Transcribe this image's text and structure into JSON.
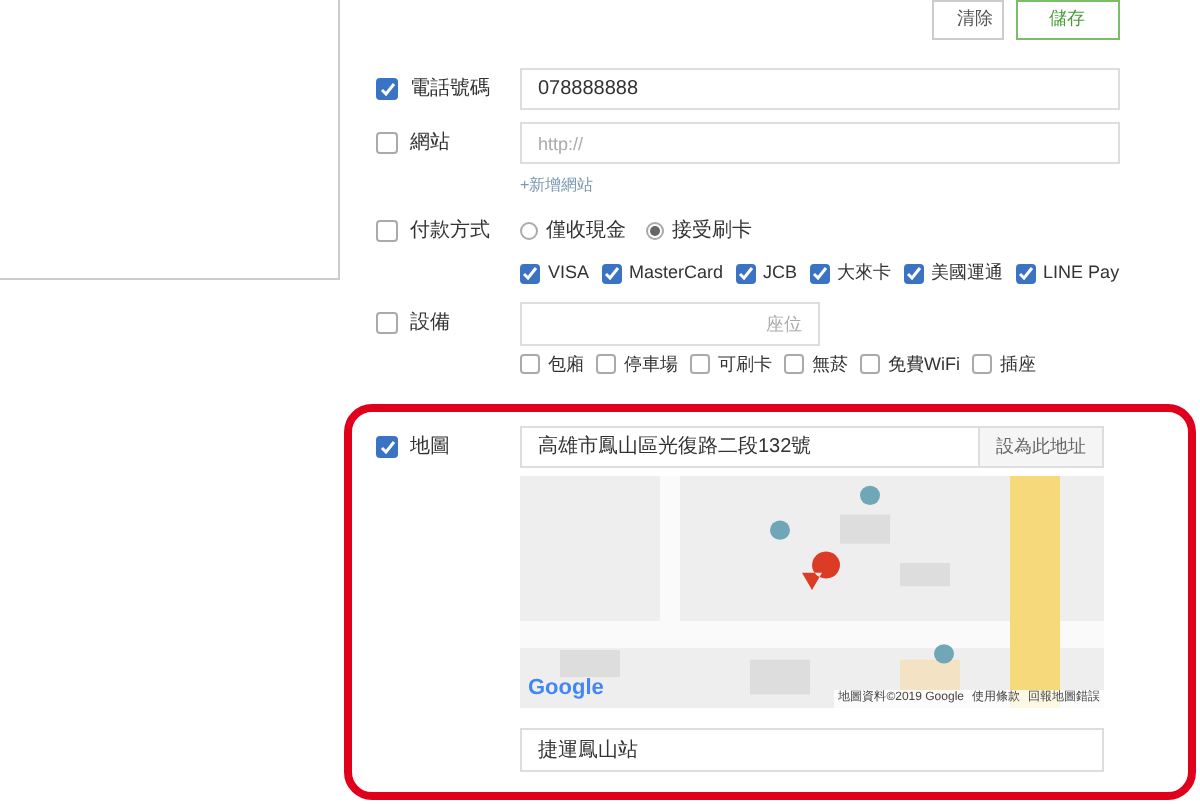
{
  "actions": [
    {
      "label": "清除",
      "kind": "plain"
    },
    {
      "label": "儲存",
      "kind": "primary"
    }
  ],
  "phone": {
    "label": "電話號碼",
    "checked": true,
    "value": "078888888"
  },
  "website": {
    "label": "網站",
    "checked": false,
    "placeholder": "http://",
    "add_link": "+新增網站"
  },
  "payment": {
    "label": "付款方式",
    "checked": false,
    "options": [
      {
        "label": "僅收現金",
        "selected": false
      },
      {
        "label": "接受刷卡",
        "selected": true
      }
    ],
    "cards": [
      {
        "label": "VISA",
        "checked": true
      },
      {
        "label": "MasterCard",
        "checked": true
      },
      {
        "label": "JCB",
        "checked": true
      },
      {
        "label": "大來卡",
        "checked": true
      },
      {
        "label": "美國運通",
        "checked": true
      },
      {
        "label": "LINE Pay",
        "checked": true
      }
    ]
  },
  "facilities": {
    "label": "設備",
    "checked": false,
    "placeholder": "座位",
    "items": [
      {
        "label": "包廂",
        "checked": false
      },
      {
        "label": "停車場",
        "checked": false
      },
      {
        "label": "可刷卡",
        "checked": false
      },
      {
        "label": "無菸",
        "checked": false
      },
      {
        "label": "免費WiFi",
        "checked": false
      },
      {
        "label": "插座",
        "checked": false
      }
    ]
  },
  "map": {
    "label": "地圖",
    "checked": true,
    "address": "高雄市鳳山區光復路二段132號",
    "set_button": "設為此地址",
    "logo": "Google",
    "attribution": "地圖資料©2019 Google",
    "terms": "使用條款",
    "report": "回報地圖錯誤",
    "landmark": "捷運鳳山站"
  }
}
